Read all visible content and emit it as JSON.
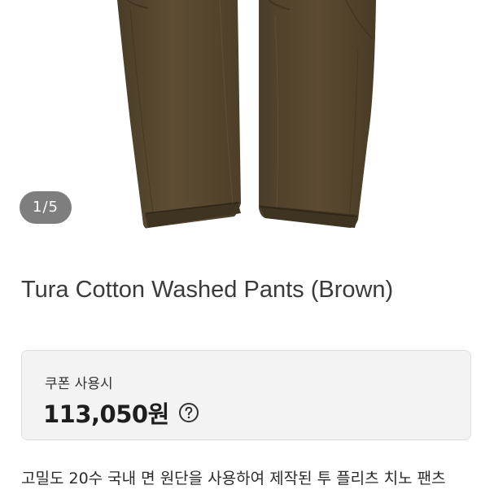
{
  "product": {
    "image_counter": "1/5",
    "title": "Tura Cotton Washed Pants (Brown)",
    "image_alt": "brown chino pants"
  },
  "price_card": {
    "coupon_label": "쿠폰 사용시",
    "price": "113,050원",
    "help_icon": "question-circle-icon"
  },
  "description": {
    "text": "고밀도 20수 국내 면 원단을 사용하여 제작된 투 플리츠 치노 팬츠"
  },
  "colors": {
    "pants_brown": "#5a4a30",
    "pants_shadow": "#3f3322",
    "counter_bg": "#5a5a5a",
    "card_bg": "#f3f3f3",
    "card_border": "#dedede",
    "title_text": "#3a3a3a"
  }
}
